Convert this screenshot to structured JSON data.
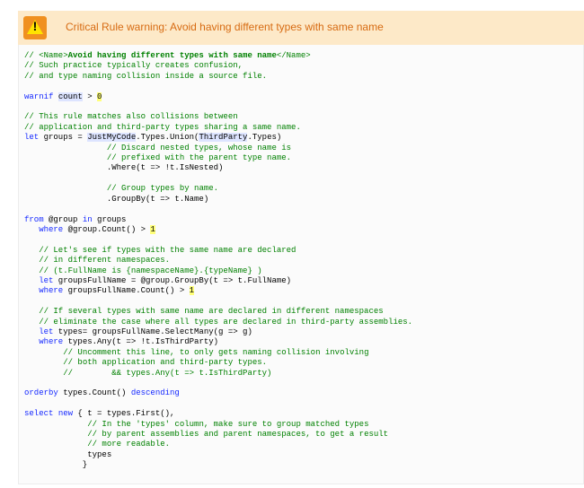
{
  "banner": {
    "icon": "warning-triangle-icon",
    "text": "Critical Rule warning: Avoid having different types with same name",
    "background": "#fde9c8",
    "text_color": "#d76b12"
  },
  "code": {
    "colors": {
      "comment": "#008000",
      "keyword": "#1428ff",
      "number_highlight": "#ffff7a"
    },
    "lines": [
      [
        {
          "t": "// <Name>",
          "c": "cm"
        },
        {
          "t": "Avoid having different types with same name",
          "c": "cm b"
        },
        {
          "t": "</Name>",
          "c": "cm"
        }
      ],
      [
        {
          "t": "// Such practice typically creates confusion,",
          "c": "cm"
        }
      ],
      [
        {
          "t": "// and type naming collision inside a source file.",
          "c": "cm"
        }
      ],
      [],
      [
        {
          "t": "warnif",
          "c": "kw"
        },
        {
          "t": " "
        },
        {
          "t": "count",
          "c": "hl"
        },
        {
          "t": " > "
        },
        {
          "t": "0",
          "c": "num"
        }
      ],
      [],
      [
        {
          "t": "// This rule matches also collisions between",
          "c": "cm"
        }
      ],
      [
        {
          "t": "// application and third-party types sharing a same name.",
          "c": "cm"
        }
      ],
      [
        {
          "t": "let",
          "c": "kw"
        },
        {
          "t": " groups = "
        },
        {
          "t": "JustMyCode",
          "c": "hl"
        },
        {
          "t": ".Types.Union("
        },
        {
          "t": "ThirdParty",
          "c": "hl"
        },
        {
          "t": ".Types)"
        }
      ],
      [
        {
          "t": "                 "
        },
        {
          "t": "// Discard nested types, whose name is",
          "c": "cm"
        }
      ],
      [
        {
          "t": "                 "
        },
        {
          "t": "// prefixed with the parent type name.",
          "c": "cm"
        }
      ],
      [
        {
          "t": "                 .Where(t => !t.IsNested)"
        }
      ],
      [],
      [
        {
          "t": "                 "
        },
        {
          "t": "// Group types by name.",
          "c": "cm"
        }
      ],
      [
        {
          "t": "                 .GroupBy(t => t.Name)"
        }
      ],
      [],
      [
        {
          "t": "from",
          "c": "kw"
        },
        {
          "t": " @group "
        },
        {
          "t": "in",
          "c": "kw"
        },
        {
          "t": " groups"
        }
      ],
      [
        {
          "t": "   "
        },
        {
          "t": "where",
          "c": "kw"
        },
        {
          "t": " @group.Count() > "
        },
        {
          "t": "1",
          "c": "num"
        }
      ],
      [],
      [
        {
          "t": "   "
        },
        {
          "t": "// Let's see if types with the same name are declared",
          "c": "cm"
        }
      ],
      [
        {
          "t": "   "
        },
        {
          "t": "// in different namespaces.",
          "c": "cm"
        }
      ],
      [
        {
          "t": "   "
        },
        {
          "t": "// (t.FullName is {namespaceName}.{typeName} )",
          "c": "cm"
        }
      ],
      [
        {
          "t": "   "
        },
        {
          "t": "let",
          "c": "kw"
        },
        {
          "t": " groupsFullName = @group.GroupBy(t => t.FullName)"
        }
      ],
      [
        {
          "t": "   "
        },
        {
          "t": "where",
          "c": "kw"
        },
        {
          "t": " groupsFullName.Count() > "
        },
        {
          "t": "1",
          "c": "num"
        }
      ],
      [],
      [
        {
          "t": "   "
        },
        {
          "t": "// If several types with same name are declared in different namespaces",
          "c": "cm"
        }
      ],
      [
        {
          "t": "   "
        },
        {
          "t": "// eliminate the case where all types are declared in third-party assemblies.",
          "c": "cm"
        }
      ],
      [
        {
          "t": "   "
        },
        {
          "t": "let",
          "c": "kw"
        },
        {
          "t": " types= groupsFullName.SelectMany(g => g)"
        }
      ],
      [
        {
          "t": "   "
        },
        {
          "t": "where",
          "c": "kw"
        },
        {
          "t": " types.Any(t => !t.IsThirdParty)"
        }
      ],
      [
        {
          "t": "        "
        },
        {
          "t": "// Uncomment this line, to only gets naming collision involving",
          "c": "cm"
        }
      ],
      [
        {
          "t": "        "
        },
        {
          "t": "// both application and third-party types.",
          "c": "cm"
        }
      ],
      [
        {
          "t": "        "
        },
        {
          "t": "//        && types.Any(t => t.IsThirdParty)",
          "c": "cm"
        }
      ],
      [],
      [
        {
          "t": "orderby",
          "c": "kw"
        },
        {
          "t": " types.Count() "
        },
        {
          "t": "descending",
          "c": "kw"
        }
      ],
      [],
      [
        {
          "t": "select",
          "c": "kw"
        },
        {
          "t": " "
        },
        {
          "t": "new",
          "c": "kw"
        },
        {
          "t": " { t = types.First(),"
        }
      ],
      [
        {
          "t": "             "
        },
        {
          "t": "// In the 'types' column, make sure to group matched types",
          "c": "cm"
        }
      ],
      [
        {
          "t": "             "
        },
        {
          "t": "// by parent assemblies and parent namespaces, to get a result",
          "c": "cm"
        }
      ],
      [
        {
          "t": "             "
        },
        {
          "t": "// more readable.",
          "c": "cm"
        }
      ],
      [
        {
          "t": "             types"
        }
      ],
      [
        {
          "t": "            }"
        }
      ]
    ]
  }
}
